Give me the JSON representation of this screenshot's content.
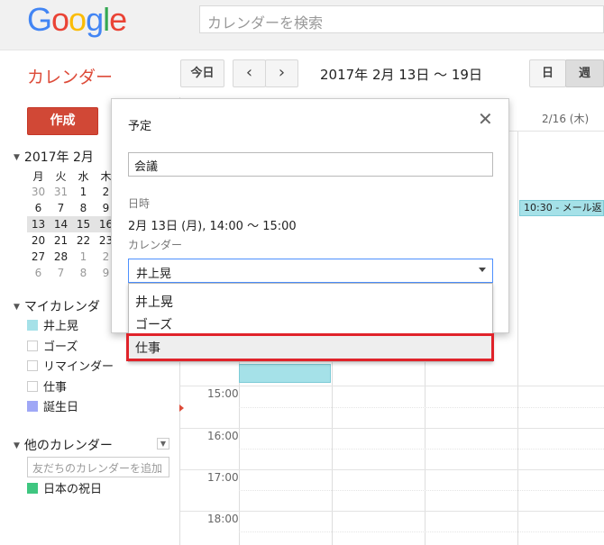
{
  "header": {
    "logo_letters": [
      "G",
      "o",
      "o",
      "g",
      "l",
      "e"
    ],
    "logo_colors": [
      "#4285f4",
      "#ea4335",
      "#fbbc05",
      "#4285f4",
      "#34a853",
      "#ea4335"
    ],
    "search_placeholder": "カレンダーを検索"
  },
  "toolbar": {
    "app_title": "カレンダー",
    "today_label": "今日",
    "prev_label": "‹",
    "next_label": "›",
    "date_range": "2017年 2月 13日 ～ 19日",
    "day_label": "日",
    "week_label": "週"
  },
  "sidebar": {
    "create_label": "作成",
    "mini_month": "2017年 2月",
    "weekday_headers": [
      "月",
      "火",
      "水",
      "木"
    ],
    "weeks": [
      [
        {
          "d": "30",
          "dim": true
        },
        {
          "d": "31",
          "dim": true
        },
        {
          "d": "1"
        },
        {
          "d": "2"
        }
      ],
      [
        {
          "d": "6"
        },
        {
          "d": "7"
        },
        {
          "d": "8"
        },
        {
          "d": "9"
        }
      ],
      [
        {
          "d": "13"
        },
        {
          "d": "14"
        },
        {
          "d": "15"
        },
        {
          "d": "16"
        }
      ],
      [
        {
          "d": "20"
        },
        {
          "d": "21"
        },
        {
          "d": "22"
        },
        {
          "d": "23"
        }
      ],
      [
        {
          "d": "27"
        },
        {
          "d": "28"
        },
        {
          "d": "1",
          "dim": true
        },
        {
          "d": "2",
          "dim": true
        }
      ],
      [
        {
          "d": "6",
          "dim": true
        },
        {
          "d": "7",
          "dim": true
        },
        {
          "d": "8",
          "dim": true
        },
        {
          "d": "9",
          "dim": true
        }
      ]
    ],
    "my_calendars_heading": "マイカレンダ",
    "my_calendars": [
      {
        "label": "井上晃",
        "color": "#a5e1e8"
      },
      {
        "label": "ゴーズ",
        "color": ""
      },
      {
        "label": "リマインダー",
        "color": ""
      },
      {
        "label": "仕事",
        "color": ""
      },
      {
        "label": "誕生日",
        "color": "#9fa7f6"
      }
    ],
    "other_calendars_heading": "他のカレンダー",
    "friend_placeholder": "友だちのカレンダーを追加",
    "other_calendars": [
      {
        "label": "日本の祝日",
        "color": "#3fc680"
      }
    ]
  },
  "grid": {
    "column_header": "2/16 (木)",
    "times": [
      "15:00",
      "16:00",
      "17:00",
      "18:00"
    ],
    "event_label": "10:30 - メール返"
  },
  "dialog": {
    "title": "予定",
    "close_label": "✕",
    "event_title_value": "会議",
    "when_label": "日時",
    "when_value": "2月 13日 (月), 14:00 ～ 15:00",
    "calendar_label": "カレンダー",
    "calendar_selected": "井上晃",
    "options": [
      "井上晃",
      "ゴーズ",
      "仕事"
    ]
  }
}
